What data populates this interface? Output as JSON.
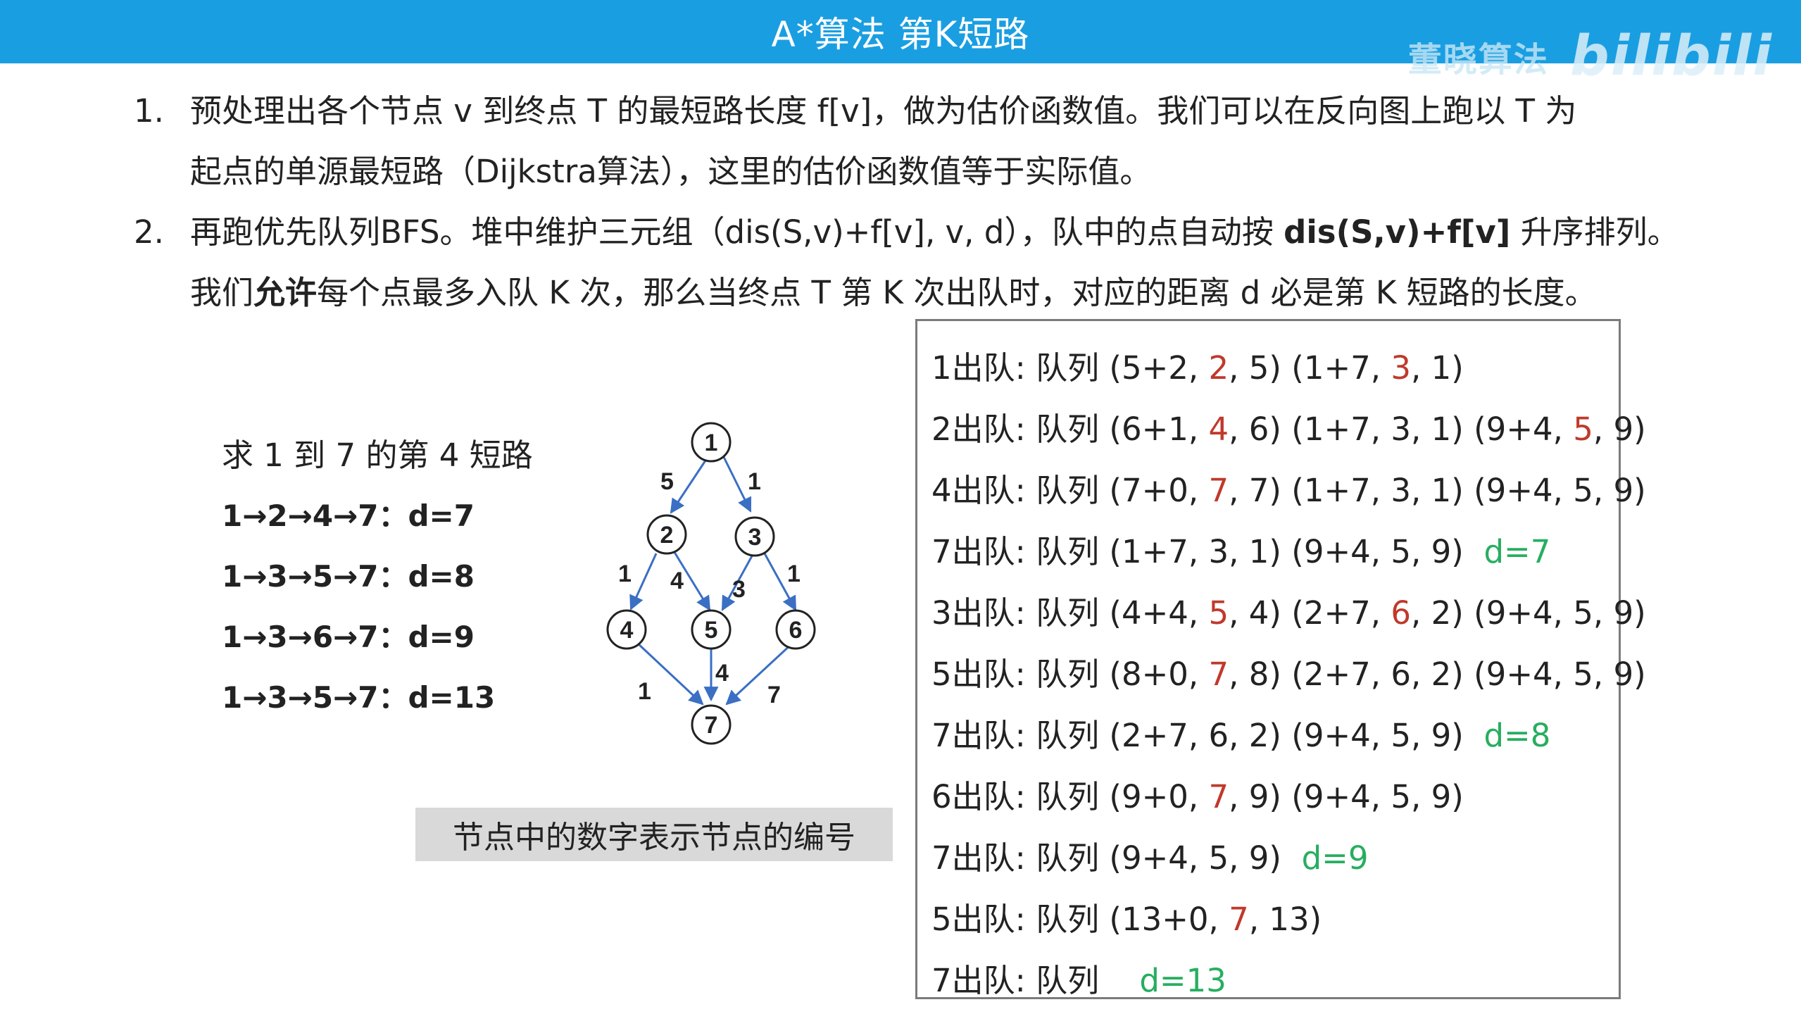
{
  "header": {
    "title": "A*算法 第K短路",
    "watermark_text": "董晓算法",
    "watermark_logo": "bilibili"
  },
  "steps": [
    {
      "num": "1.",
      "line1": "预处理出各个节点 v 到终点 T 的最短路长度 f[v]，做为估价函数值。我们可以在反向图上跑以 T 为",
      "line2": "起点的单源最短路（Dijkstra算法），这里的估价函数值等于实际值。"
    },
    {
      "num": "2.",
      "line1_a": "再跑优先队列BFS。堆中维护三元组（dis(S,v)+f[v], v, d），队中的点自动按 ",
      "line1_b": "dis(S,v)+f[v]",
      "line1_c": " 升序排列。",
      "line2_a": "我们",
      "line2_b": "允许",
      "line2_c": "每个点最多入队 K 次，那么当终点 T 第 K 次出队时，对应的距离 d 必是第 K 短路的长度。"
    }
  ],
  "question": "求 1 到 7 的第 4 短路",
  "paths": [
    "1→2→4→7：d=7",
    "1→3→5→7：d=8",
    "1→3→6→7：d=9",
    "1→3→5→7：d=13"
  ],
  "graph": {
    "nodes": [
      "1",
      "2",
      "3",
      "4",
      "5",
      "6",
      "7"
    ],
    "edge_weights": {
      "e12": "5",
      "e13": "1",
      "e24": "1",
      "e25": "4",
      "e35": "3",
      "e36": "1",
      "e47": "1",
      "e57": "4",
      "e67": "7"
    }
  },
  "note": "节点中的数字表示节点的编号",
  "queue": [
    {
      "prefix": "1出队: 队列 (5+2, ",
      "red1": "2",
      "mid1": ", 5) (1+7, ",
      "red2": "3",
      "suffix": ", 1)",
      "green": ""
    },
    {
      "prefix": "2出队: 队列 (6+1, ",
      "red1": "4",
      "mid1": ", 6) (1+7, 3, 1) (9+4, ",
      "red2": "5",
      "suffix": ", 9)",
      "green": ""
    },
    {
      "prefix": "4出队: 队列 (7+0, ",
      "red1": "7",
      "mid1": ", 7) (1+7, 3, 1) (9+4, 5, 9)",
      "red2": "",
      "suffix": "",
      "green": ""
    },
    {
      "prefix": "7出队: 队列 (1+7, 3, 1) (9+4, 5, 9)",
      "red1": "",
      "mid1": "",
      "red2": "",
      "suffix": "",
      "green": "d=7"
    },
    {
      "prefix": "3出队: 队列 (4+4, ",
      "red1": "5",
      "mid1": ", 4) (2+7, ",
      "red2": "6",
      "suffix": ", 2) (9+4, 5, 9)",
      "green": ""
    },
    {
      "prefix": "5出队: 队列 (8+0, ",
      "red1": "7",
      "mid1": ", 8) (2+7, 6, 2) (9+4, 5, 9)",
      "red2": "",
      "suffix": "",
      "green": ""
    },
    {
      "prefix": "7出队: 队列 (2+7, 6, 2) (9+4, 5, 9)",
      "red1": "",
      "mid1": "",
      "red2": "",
      "suffix": "",
      "green": "d=8"
    },
    {
      "prefix": "6出队: 队列 (9+0, ",
      "red1": "7",
      "mid1": ", 9) (9+4, 5, 9)",
      "red2": "",
      "suffix": "",
      "green": ""
    },
    {
      "prefix": "7出队: 队列 (9+4, 5, 9)",
      "red1": "",
      "mid1": "",
      "red2": "",
      "suffix": "",
      "green": "d=9"
    },
    {
      "prefix": "5出队: 队列 (13+0, ",
      "red1": "7",
      "mid1": ", 13)",
      "red2": "",
      "suffix": "",
      "green": ""
    },
    {
      "prefix": "7出队: 队列 ",
      "red1": "",
      "mid1": "",
      "red2": "",
      "suffix": "",
      "green": "d=13"
    }
  ],
  "colors": {
    "title_bar": "#1a9ee2",
    "highlight_red": "#c0392b",
    "highlight_green": "#27ae60",
    "edge": "#3a6fc4"
  }
}
